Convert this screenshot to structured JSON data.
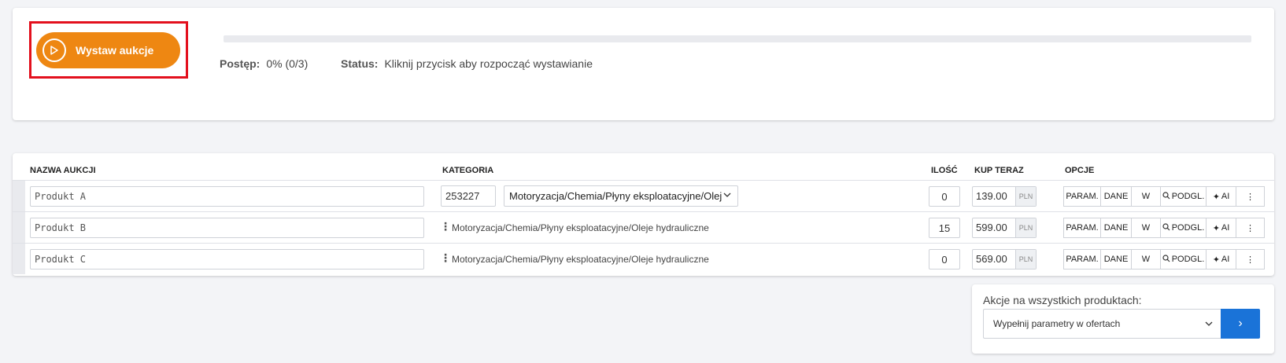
{
  "top": {
    "start_button_label": "Wystaw aukcje",
    "progress_label": "Postęp:",
    "progress_value": "0% (0/3)",
    "progress_fraction": 0,
    "status_label": "Status:",
    "status_value": "Kliknij przycisk aby rozpocząć wystawianie"
  },
  "table": {
    "headers": {
      "name": "NAZWA AUKCJI",
      "category": "KATEGORIA",
      "qty": "ILOŚĆ",
      "buy_now": "KUP TERAZ",
      "options": "OPCJE"
    },
    "rows": [
      {
        "name": "Produkt A",
        "category_id": "253227",
        "category_path": "Motoryzacja/Chemia/Płyny eksploatacyjne/Oleje hydrauliczne",
        "qty": "0",
        "price": "139.00",
        "currency": "PLN"
      },
      {
        "name": "Produkt B",
        "category_path": "Motoryzacja/Chemia/Płyny eksploatacyjne/Oleje hydrauliczne",
        "qty": "15",
        "price": "599.00",
        "currency": "PLN"
      },
      {
        "name": "Produkt C",
        "category_path": "Motoryzacja/Chemia/Płyny eksploatacyjne/Oleje hydrauliczne",
        "qty": "0",
        "price": "569.00",
        "currency": "PLN"
      }
    ],
    "option_buttons": {
      "param": "PARAM.",
      "dane": "DANE",
      "w": "W",
      "preview": "PODGL.",
      "ai": "AI",
      "more": "⋮"
    }
  },
  "bulk": {
    "label": "Akcje na wszystkich produktach:",
    "selected": "Wypełnij parametry w ofertach",
    "go": "›"
  },
  "colors": {
    "accent_orange": "#ee8712",
    "highlight_red": "#e3101d",
    "primary_blue": "#1a73d8"
  }
}
